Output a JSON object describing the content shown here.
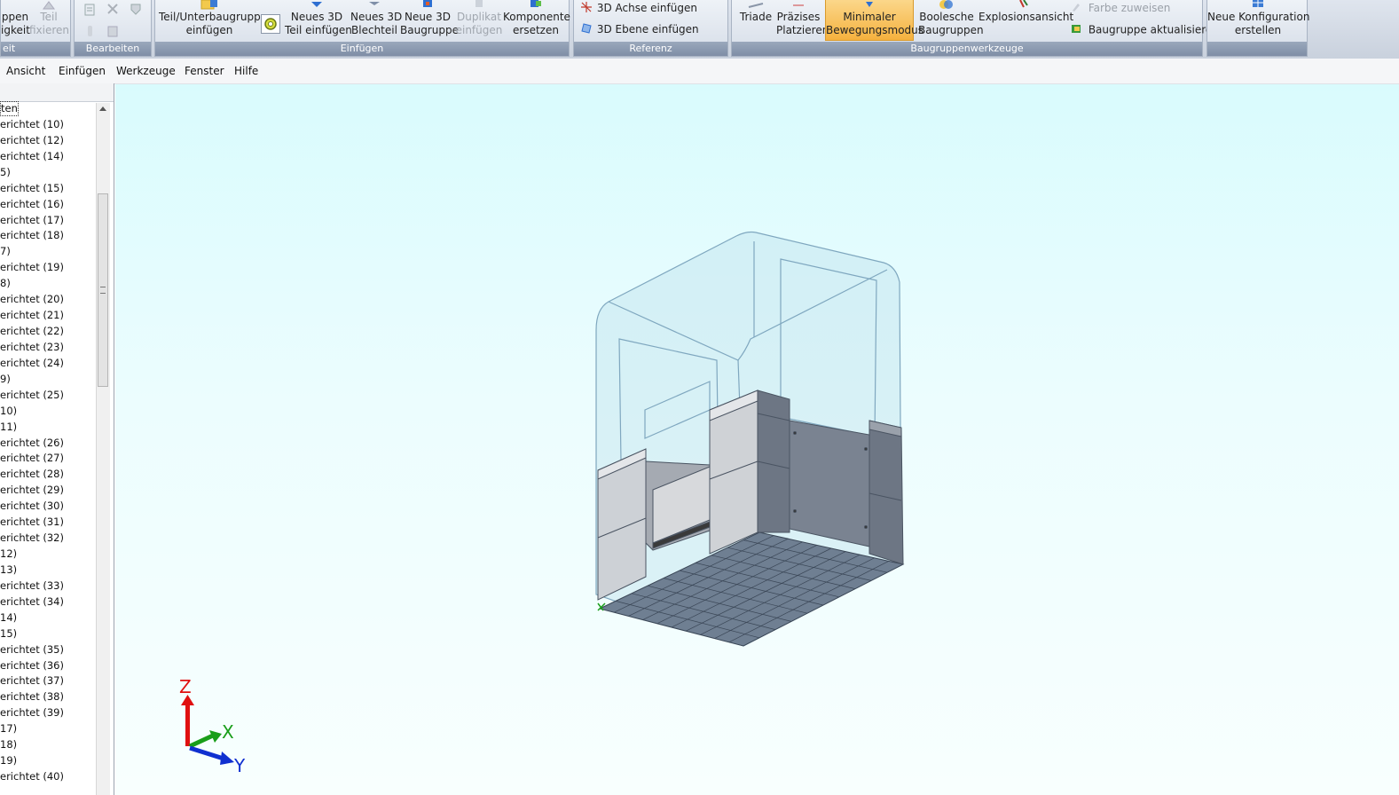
{
  "ribbon": {
    "groups": [
      {
        "label": "eit",
        "buttons": [
          {
            "l1": "ppen",
            "l2": "igkeit"
          },
          {
            "l1": "Teil",
            "l2": "fixieren",
            "disabled": true
          }
        ]
      },
      {
        "label": "Bearbeiten"
      },
      {
        "label": "Einfügen",
        "buttons": [
          {
            "l1": "Teil/Unterbaugruppe",
            "l2": "einfügen"
          },
          {
            "l1": "Neues 3D",
            "l2": "Teil einfügen"
          },
          {
            "l1": "Neues 3D",
            "l2": "Blechteil"
          },
          {
            "l1": "Neue 3D",
            "l2": "Baugruppe"
          },
          {
            "l1": "Duplikat",
            "l2": "einfügen",
            "disabled": true
          },
          {
            "l1": "Komponente",
            "l2": "ersetzen"
          }
        ]
      },
      {
        "label": "Referenz",
        "small": [
          {
            "label": "3D Achse einfügen"
          },
          {
            "label": "3D Ebene einfügen"
          }
        ]
      },
      {
        "label": "Baugruppenwerkzeuge",
        "buttons": [
          {
            "l1": "Triade",
            "l2": ""
          },
          {
            "l1": "Präzises",
            "l2": "Platzieren"
          },
          {
            "l1": "Minimaler",
            "l2": "Bewegungsmodus",
            "active": true
          },
          {
            "l1": "Boolesche",
            "l2": "Baugruppen"
          },
          {
            "l1": "Explosionsansicht",
            "l2": ""
          }
        ],
        "small": [
          {
            "label": "Farbe zuweisen",
            "disabled": true
          },
          {
            "label": "Baugruppe aktualisieren"
          }
        ]
      },
      {
        "label": "",
        "buttons": [
          {
            "l1": "Neue Konfiguration",
            "l2": "erstellen"
          }
        ]
      }
    ]
  },
  "menu": [
    "Ansicht",
    "Einfügen",
    "Werkzeuge",
    "Fenster",
    "Hilfe"
  ],
  "tree": {
    "rows": [
      "ten",
      "erichtet (10)",
      "erichtet (12)",
      "erichtet (14)",
      "5)",
      "erichtet (15)",
      "erichtet (16)",
      "erichtet (17)",
      "erichtet (18)",
      "7)",
      "erichtet (19)",
      "8)",
      "erichtet (20)",
      "erichtet (21)",
      "erichtet (22)",
      "erichtet (23)",
      "erichtet (24)",
      "9)",
      "erichtet (25)",
      "10)",
      "11)",
      "erichtet (26)",
      "erichtet (27)",
      "erichtet (28)",
      "erichtet (29)",
      "erichtet (30)",
      "erichtet (31)",
      "erichtet (32)",
      "12)",
      "13)",
      "erichtet (33)",
      "erichtet (34)",
      "14)",
      "15)",
      "erichtet (35)",
      "erichtet (36)",
      "erichtet (37)",
      "erichtet (38)",
      "erichtet (39)",
      "17)",
      "18)",
      "19)",
      "erichtet (40)"
    ]
  },
  "triad": {
    "z": "Z",
    "x": "X",
    "y": "Y",
    "colors": {
      "z": "#e01010",
      "x": "#1a9e1a",
      "y": "#1030d0"
    }
  },
  "colors": {
    "accent": "#f5b13e",
    "viewport_top": "#d9fbfd",
    "viewport_bottom": "#f8fffe"
  }
}
